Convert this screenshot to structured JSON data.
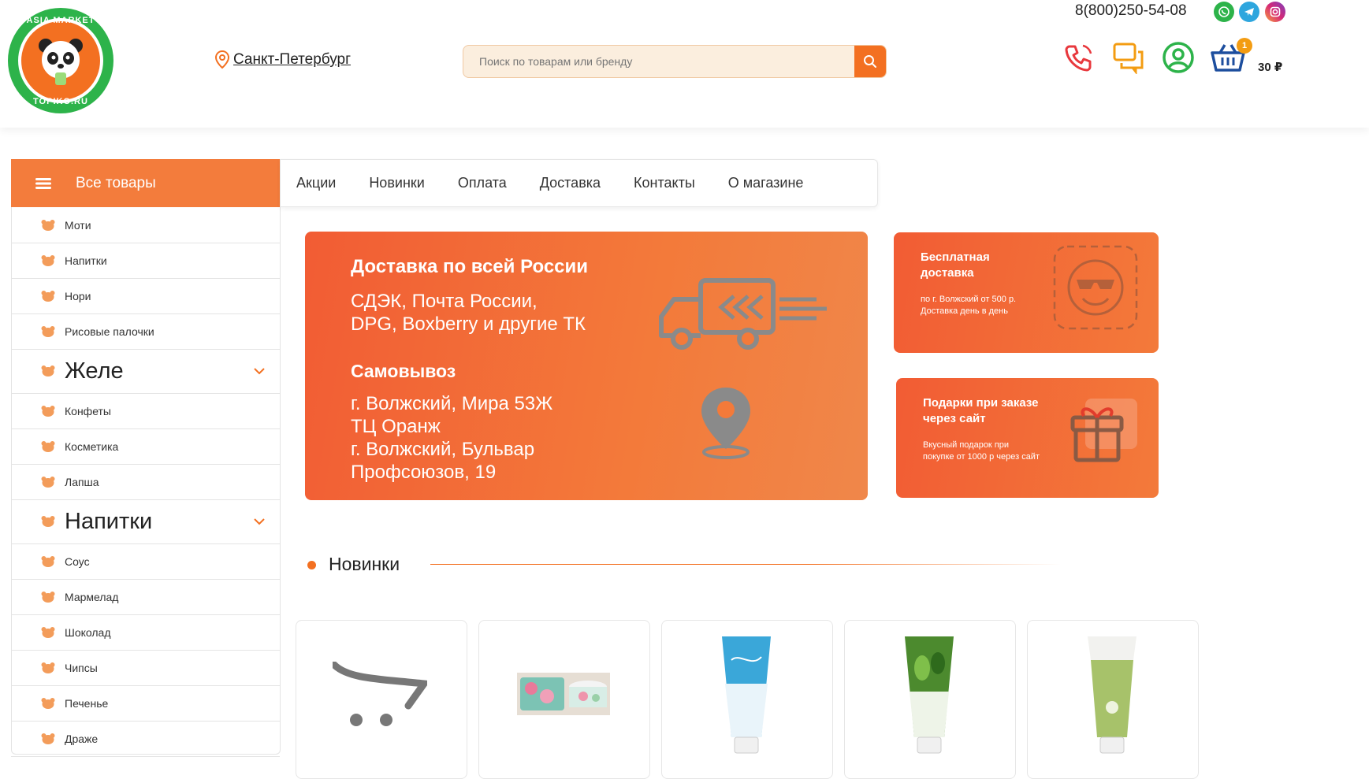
{
  "header": {
    "logo_top_text": "ASIA MARKET",
    "logo_bottom_text": "TOPIKO.RU",
    "city": "Санкт-Петербург",
    "search_placeholder": "Поиск по товарам или бренду",
    "phone": "8(800)250-54-08",
    "cart_count": "1",
    "cart_sum": "30 ₽",
    "social": [
      "whatsapp-icon",
      "telegram-icon",
      "instagram-icon"
    ]
  },
  "sidebar": {
    "all_goods": "Все товары",
    "items": [
      {
        "label": "Моти",
        "big": false
      },
      {
        "label": "Напитки",
        "big": false
      },
      {
        "label": "Нори",
        "big": false
      },
      {
        "label": "Рисовые палочки",
        "big": false
      },
      {
        "label": "Желе",
        "big": true
      },
      {
        "label": "Конфеты",
        "big": false
      },
      {
        "label": "Косметика",
        "big": false
      },
      {
        "label": "Лапша",
        "big": false
      },
      {
        "label": "Напитки",
        "big": true
      },
      {
        "label": "Соус",
        "big": false
      },
      {
        "label": "Мармелад",
        "big": false
      },
      {
        "label": "Шоколад",
        "big": false
      },
      {
        "label": "Чипсы",
        "big": false
      },
      {
        "label": "Печенье",
        "big": false
      },
      {
        "label": "Драже",
        "big": false
      }
    ]
  },
  "nav": [
    "Акции",
    "Новинки",
    "Оплата",
    "Доставка",
    "Контакты",
    "О магазине"
  ],
  "banner_main": {
    "title": "Доставка по всей России",
    "line1": "СДЭК, Почта России,",
    "line2": "DPG, Boxberry и другие ТК",
    "pickup_title": "Самовывоз",
    "pickup1": "г. Волжский, Мира 53Ж",
    "pickup2": "ТЦ Оранж",
    "pickup3": "г. Волжский, Бульвар",
    "pickup4": "Профсоюзов, 19"
  },
  "banner_free": {
    "title1": "Бесплатная",
    "title2": "доставка",
    "text1": "по г. Волжский от 500 р.",
    "text2": "Доставка день в день"
  },
  "banner_gift": {
    "title1": "Подарки при заказе",
    "title2": "через сайт",
    "text1": "Вкусный подарок при",
    "text2": "покупке от 1000 р через сайт"
  },
  "section": {
    "title": "Новинки"
  },
  "colors": {
    "accent": "#f37021",
    "green": "#2db34a",
    "icon_red": "#e8383d"
  }
}
